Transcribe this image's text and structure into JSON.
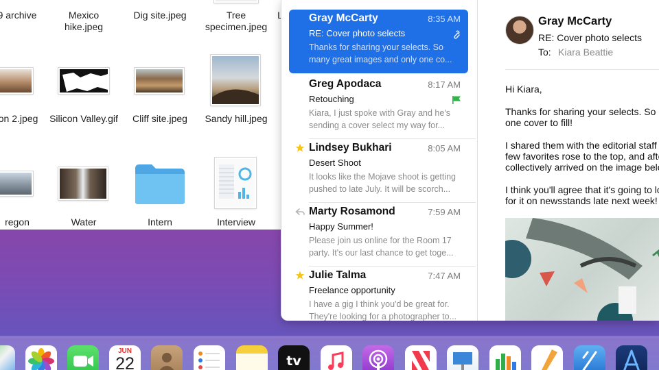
{
  "finder": {
    "items": [
      {
        "name_lines": [
          "9 archive"
        ]
      },
      {
        "name_lines": [
          "Mexico",
          "hike.jpeg"
        ]
      },
      {
        "name_lines": [
          "Dig site.jpeg"
        ]
      },
      {
        "name_lines": [
          "Tree",
          "specimen.jpeg"
        ]
      },
      {
        "name_lines": [
          "L"
        ]
      },
      {
        "name_lines": [
          "ion 2.jpeg"
        ]
      },
      {
        "name_lines": [
          "Silicon Valley.gif"
        ]
      },
      {
        "name_lines": [
          "Cliff site.jpeg"
        ]
      },
      {
        "name_lines": [
          "Sandy hill.jpeg"
        ]
      },
      {
        "name_lines": [
          "regon"
        ]
      },
      {
        "name_lines": [
          "Water"
        ]
      },
      {
        "name_lines": [
          "Intern"
        ]
      },
      {
        "name_lines": [
          "Interview"
        ]
      }
    ]
  },
  "mail": {
    "messages": [
      {
        "sender": "Gray McCarty",
        "time": "8:35 AM",
        "subject": "RE: Cover photo selects",
        "preview": "Thanks for sharing your selects. So\nmany great images and only one co...",
        "selected": true,
        "marker": "paperclip-icon"
      },
      {
        "sender": "Greg Apodaca",
        "time": "8:17 AM",
        "subject": "Retouching",
        "preview": "Kiara, I just spoke with Gray and he's\nsending a cover select my way for...",
        "selected": false,
        "marker": "flag-icon"
      },
      {
        "sender": "Lindsey Bukhari",
        "time": "8:05 AM",
        "subject": "Desert Shoot",
        "preview": "It looks like the Mojave shoot is getting\npushed to late July. It will be scorch...",
        "selected": false,
        "marker": "star-icon"
      },
      {
        "sender": "Marty Rosamond",
        "time": "7:59 AM",
        "subject": "Happy Summer!",
        "preview": "Please join us online for the Room 17\nparty. It's our last chance to get toge...",
        "selected": false,
        "marker": "reply-icon"
      },
      {
        "sender": "Julie Talma",
        "time": "7:47 AM",
        "subject": "Freelance opportunity",
        "preview": "I have a gig I think you'd be great for.\nThey're looking for a photographer to...",
        "selected": false,
        "marker": "star-icon"
      }
    ],
    "reader": {
      "from": "Gray McCarty",
      "subject": "RE: Cover photo selects",
      "to_label": "To:",
      "to": "Kiara Beattie",
      "body": [
        "Hi Kiara,",
        "Thanks for sharing your selects. So m\none cover to fill!",
        "I shared them with the editorial staff a\nfew favorites rose to the top, and afte\ncollectively arrived on the image below",
        "I think you'll agree that it's going to loo\nfor it on newsstands late next week!"
      ]
    }
  },
  "dock": {
    "calendar_month": "JUN",
    "calendar_day": "22",
    "appletv_label": "tv",
    "icons": [
      "maps-icon",
      "photos-icon",
      "facetime-icon",
      "calendar-icon",
      "contacts-icon",
      "reminders-icon",
      "notes-icon",
      "apple-tv-icon",
      "music-icon",
      "podcasts-icon",
      "news-icon",
      "keynote-icon",
      "numbers-icon",
      "pages-icon",
      "xcode-icon",
      "instruments-icon"
    ]
  },
  "colors": {
    "accent": "#1f6fe6",
    "flag": "#30b545",
    "star": "#f5c518",
    "folder": "#5db6ef"
  }
}
